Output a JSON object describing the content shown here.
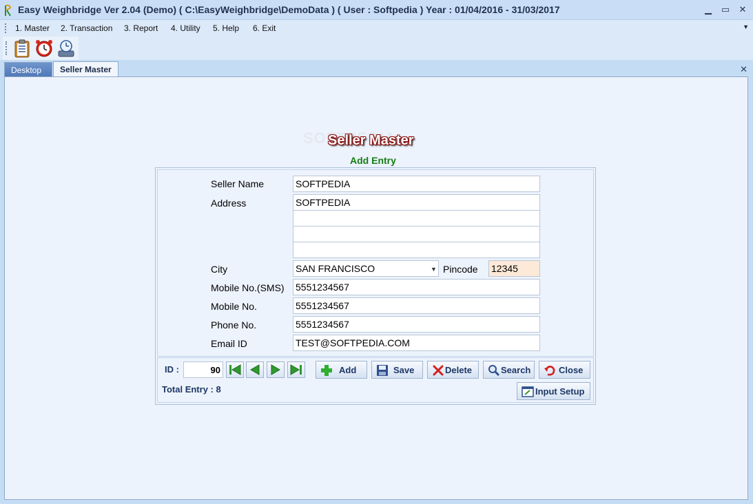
{
  "window": {
    "title": "Easy Weighbridge Ver 2.04 (Demo)    ( C:\\EasyWeighbridge\\DemoData ) ( User : Softpedia ) Year : 01/04/2016 - 31/03/2017",
    "minimize": "▁",
    "maximize": "▭",
    "close": "✕"
  },
  "menu": {
    "items": [
      "1. Master",
      "2. Transaction",
      "3. Report",
      "4. Utility",
      "5. Help",
      "6. Exit"
    ],
    "overflow": "▼"
  },
  "toolbar": {
    "icons": [
      "clipboard-icon",
      "alarm-clock-icon",
      "backup-restore-icon"
    ]
  },
  "tabs": {
    "items": [
      "Desktop",
      "Seller Master"
    ],
    "active": "Seller Master",
    "close": "✕"
  },
  "form": {
    "watermark": "SOFTPEDIA",
    "heading": "Seller Master",
    "subheading": "Add Entry",
    "labels": {
      "seller_name": "Seller Name",
      "address": "Address",
      "city": "City",
      "pincode": "Pincode",
      "mobile_sms": "Mobile No.(SMS)",
      "mobile": "Mobile No.",
      "phone": "Phone No.",
      "email": "Email ID"
    },
    "values": {
      "seller_name": "SOFTPEDIA",
      "address_1": "SOFTPEDIA",
      "address_2": "",
      "address_3": "",
      "address_4": "",
      "city": "SAN FRANCISCO",
      "pincode": "12345",
      "mobile_sms": "5551234567",
      "mobile": "5551234567",
      "phone": "5551234567",
      "email": "TEST@SOFTPEDIA.COM"
    }
  },
  "record": {
    "id_label": "ID :",
    "id_value": "90",
    "total_entry": "Total Entry : 8"
  },
  "buttons": {
    "add": "Add",
    "save": "Save",
    "delete": "Delete",
    "search": "Search",
    "close": "Close",
    "input_setup": "Input Setup"
  },
  "colors": {
    "titlebar_bg": "#c9def6",
    "heading_outline": "#8b1313",
    "subheading": "#137d13",
    "pincode_bg": "#fde9d7",
    "nav_arrow": "#2f9a2f"
  }
}
